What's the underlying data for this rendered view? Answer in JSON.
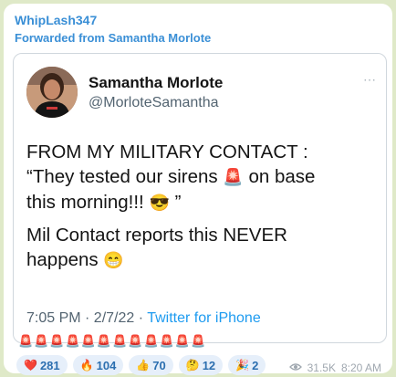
{
  "message": {
    "sender": "WhipLash347",
    "forwarded_from": "Forwarded from Samantha Morlote"
  },
  "tweet": {
    "author_name": "Samantha Morlote",
    "author_handle": "@MorloteSamantha",
    "more_icon": "⋯",
    "line1": "FROM MY MILITARY CONTACT :",
    "line2a": "“They tested our sirens",
    "line2b": "on base",
    "line3a": "this morning!!!",
    "line3b": "”",
    "line4": "Mil Contact reports this NEVER",
    "line5": "happens",
    "emoji_siren": "🚨",
    "emoji_sunglasses": "😎",
    "emoji_grin": "😁",
    "datetime": "7:05 PM · 2/7/22 · ",
    "source": "Twitter for iPhone"
  },
  "sirens_row": "🚨🚨🚨🚨🚨🚨🚨🚨🚨🚨🚨🚨",
  "reactions": [
    {
      "emoji": "❤️",
      "count": "281",
      "icon": "heart-icon"
    },
    {
      "emoji": "🔥",
      "count": "104",
      "icon": "fire-icon"
    },
    {
      "emoji": "👍",
      "count": "70",
      "icon": "thumbs-up-icon"
    },
    {
      "emoji": "🤔",
      "count": "12",
      "icon": "thinking-icon"
    },
    {
      "emoji": "🎉",
      "count": "2",
      "icon": "party-icon"
    }
  ],
  "info": {
    "views": "31.5K",
    "time": "8:20 AM"
  }
}
